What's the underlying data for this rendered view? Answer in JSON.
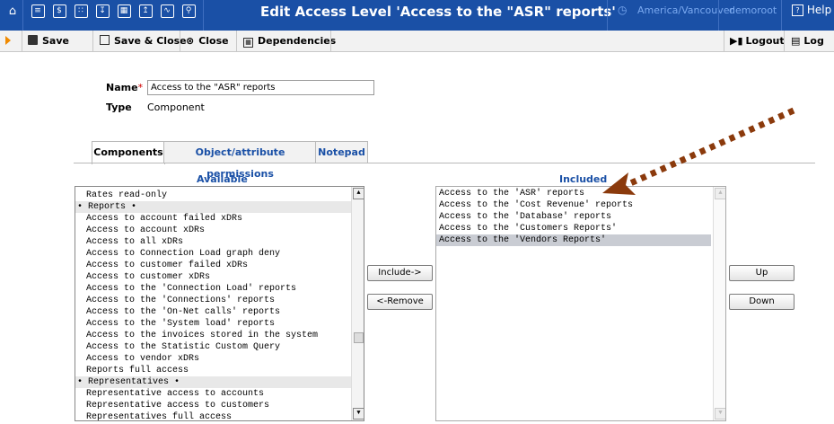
{
  "header": {
    "title": "Edit Access Level 'Access to the \"ASR\" reports'",
    "timezone": "America/Vancouver",
    "user": "demoroot",
    "help": "Help"
  },
  "toolbar": {
    "save": "Save",
    "save_close": "Save & Close",
    "close": "Close",
    "dependencies": "Dependencies",
    "logout": "Logout",
    "log": "Log"
  },
  "form": {
    "name_label": "Name",
    "name_value": "Access to the \"ASR\" reports",
    "type_label": "Type",
    "type_value": "Component"
  },
  "tabs": [
    "Components",
    "Object/attribute permissions",
    "Notepad"
  ],
  "available": {
    "heading": "Available",
    "items": [
      {
        "text": "Rates read-only",
        "group": false
      },
      {
        "text": "• Reports •",
        "group": true
      },
      {
        "text": "Access to account failed xDRs",
        "group": false
      },
      {
        "text": "Access to account xDRs",
        "group": false
      },
      {
        "text": "Access to all xDRs",
        "group": false
      },
      {
        "text": "Access to Connection Load graph deny",
        "group": false
      },
      {
        "text": "Access to customer failed xDRs",
        "group": false
      },
      {
        "text": "Access to customer xDRs",
        "group": false
      },
      {
        "text": "Access to the 'Connection Load' reports",
        "group": false
      },
      {
        "text": "Access to the 'Connections' reports",
        "group": false
      },
      {
        "text": "Access to the 'On-Net calls' reports",
        "group": false
      },
      {
        "text": "Access to the 'System load' reports",
        "group": false
      },
      {
        "text": "Access to the invoices stored in the system",
        "group": false
      },
      {
        "text": "Access to the Statistic Custom Query",
        "group": false
      },
      {
        "text": "Access to vendor xDRs",
        "group": false
      },
      {
        "text": "Reports full access",
        "group": false
      },
      {
        "text": "• Representatives •",
        "group": true
      },
      {
        "text": "Representative access to accounts",
        "group": false
      },
      {
        "text": "Representative access to customers",
        "group": false
      },
      {
        "text": "Representatives full access",
        "group": false
      }
    ]
  },
  "included": {
    "heading": "Included",
    "items": [
      {
        "text": "Access to the 'ASR' reports",
        "selected": false
      },
      {
        "text": "Access to the 'Cost Revenue' reports",
        "selected": false
      },
      {
        "text": "Access to the 'Database' reports",
        "selected": false
      },
      {
        "text": "Access to the 'Customers Reports'",
        "selected": false
      },
      {
        "text": "Access to the 'Vendors Reports'",
        "selected": true
      }
    ]
  },
  "buttons": {
    "include": "Include->",
    "remove": "<-Remove",
    "up": "Up",
    "down": "Down"
  },
  "colors": {
    "header_bg": "#1a50a6",
    "arrow": "#8b3a0c"
  }
}
